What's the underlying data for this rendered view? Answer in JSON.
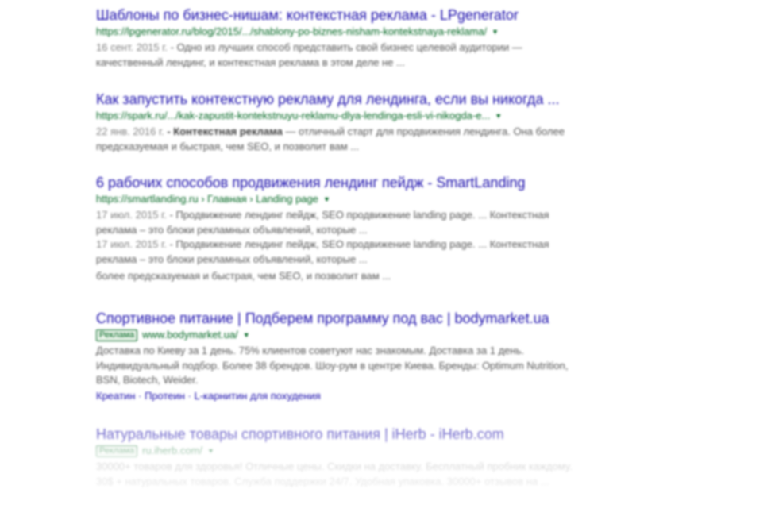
{
  "results": [
    {
      "title": "Шаблоны по бизнес-нишам: контекстная реклама - LPgenerator",
      "url": "https://lpgenerator.ru/blog/2015/.../shablony-po-biznes-nisham-kontekstnaya-reklama/",
      "snippets": [
        {
          "date": "16 сент. 2015 г.",
          "text": " - Одно из лучших способ представить свой бизнес целевой аудитории — качественный лендинг, и контекстная реклама в этом деле не ..."
        }
      ]
    },
    {
      "title": "Как запустить контекстную рекламу для лендинга, если вы никогда ...",
      "url": "https://spark.ru/.../kak-zapustit-kontekstnuyu-reklamu-dlya-lendinga-esli-vi-nikogda-e...",
      "snippets": [
        {
          "date": "22 янв. 2016 г.",
          "bold": " - Контекстная реклама",
          "text": " — отличный старт для продвижения лендинга. Она более предсказуемая и быстрая, чем SEO, и позволит вам ..."
        }
      ]
    },
    {
      "title": "6 рабочих способов продвижения лендинг пейдж - SmartLanding",
      "url": "https://smartlanding.ru › Главная › Landing page",
      "snippets": [
        {
          "date": "17 июл. 2015 г.",
          "text": " - Продвижение лендинг пейдж, SEO продвижение landing page. ... Контекстная реклама – это блоки рекламных объявлений, которые ..."
        },
        {
          "date": "17 июл. 2015 г.",
          "text": " - Продвижение лендинг пейдж, SEO продвижение landing page. ... Контекстная реклама – это блоки рекламных объявлений, которые ..."
        },
        {
          "date": "",
          "text": "более предсказуемая и быстрая, чем SEO, и позволит вам ..."
        }
      ]
    }
  ],
  "ads": [
    {
      "title": "Спортивное питание | Подберем программу под вас | bodymarket.ua",
      "badge": "Реклама",
      "url": "www.bodymarket.ua/",
      "snippet": "Доставка по Киеву за 1 день. 75% клиентов советуют нас знакомым. Доставка за 1 день. Индивидуальный подбор. Более 38 брендов. Шоу-рум в центре Киева. Бренды: Optimum Nutrition, BSN, Biotech, Weider.",
      "sitelinks": [
        "Креатин",
        "Протеин",
        "L-карнитин для похудения"
      ]
    },
    {
      "title": "Натуральные товары спортивного питания | iHerb - iHerb.com",
      "badge": "Реклама",
      "url": "ru.iherb.com/",
      "snippet": "30000+ товаров для здоровья! Отличные цены. Скидки на доставку. Бесплатный пробник каждому. 30$ + натуральных товаров. Служба поддержки 24/7. Удобная упаковка. 30000+ отзывов на ..."
    }
  ]
}
